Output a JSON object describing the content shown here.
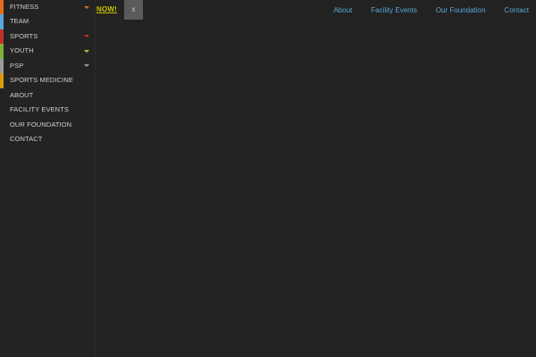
{
  "promo": {
    "cta_label": "NOW!",
    "close_label": "x"
  },
  "menu": {
    "items": [
      {
        "label": "FITNESS",
        "accent": "#e36d1f",
        "has_submenu": true,
        "caret_color": "#e36d1f"
      },
      {
        "label": "TEAM",
        "accent": "#5aa6d8",
        "has_submenu": false
      },
      {
        "label": "SPORTS",
        "accent": "#c0302d",
        "has_submenu": true,
        "caret_color": "#c0302d"
      },
      {
        "label": "YOUTH",
        "accent": "#7fae3a",
        "has_submenu": true,
        "caret_color": "#b7c33a"
      },
      {
        "label": "PSP",
        "accent": "#9a9a9a",
        "has_submenu": true,
        "caret_color": "#9a9a9a"
      },
      {
        "label": "SPORTS MEDICINE",
        "accent": "#d89a10",
        "has_submenu": false
      },
      {
        "label": "ABOUT",
        "accent": "",
        "has_submenu": false
      },
      {
        "label": "FACILITY EVENTS",
        "accent": "",
        "has_submenu": false
      },
      {
        "label": "OUR FOUNDATION",
        "accent": "",
        "has_submenu": false
      },
      {
        "label": "CONTACT",
        "accent": "",
        "has_submenu": false
      }
    ]
  },
  "topnav": {
    "about": "About",
    "facility_events": "Facility Events",
    "our_foundation": "Our Foundation",
    "contact": "Contact"
  },
  "colors": {
    "background": "#222222",
    "nav_link": "#5aa6d8",
    "promo_cta": "#c8c200"
  }
}
